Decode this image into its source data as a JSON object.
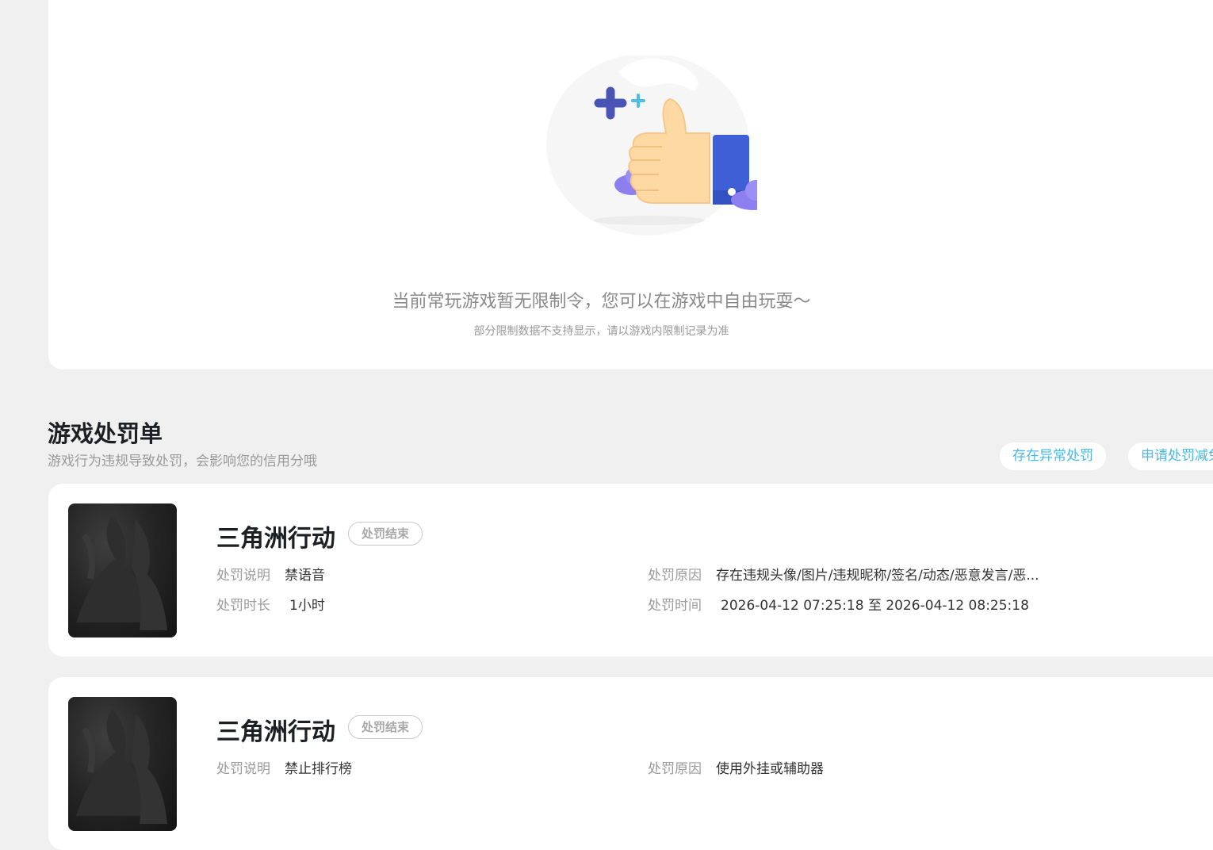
{
  "empty_state": {
    "message": "当前常玩游戏暂无限制令，您可以在游戏中自由玩耍～",
    "note": "部分限制数据不支持显示，请以游戏内限制记录为准"
  },
  "penalty_section": {
    "title": "游戏处罚单",
    "subtitle": "游戏行为违规导致处罚，会影响您的信用分哦",
    "actions": [
      "存在异常处罚",
      "申请处罚减免"
    ]
  },
  "penalties": [
    {
      "game": "三角洲行动",
      "status": "处罚结束",
      "desc_label": "处罚说明",
      "desc": "禁语音",
      "duration_label": "处罚时长",
      "duration": "1小时",
      "reason_label": "处罚原因",
      "reason": "存在违规头像/图片/违规昵称/签名/动态/恶意发言/恶...",
      "time_label": "处罚时间",
      "time": "2026-04-12 07:25:18 至 2026-04-12 08:25:18"
    },
    {
      "game": "三角洲行动",
      "status": "处罚结束",
      "desc_label": "处罚说明",
      "desc": "禁止排行榜",
      "reason_label": "处罚原因",
      "reason": "使用外挂或辅助器"
    }
  ],
  "colors": {
    "page_bg": "#f0f0f0",
    "card_bg": "#ffffff",
    "accent": "#4bb9e8",
    "thumb_blue": "#3f5fd6",
    "cloud_purple": "#8d7ff0"
  }
}
